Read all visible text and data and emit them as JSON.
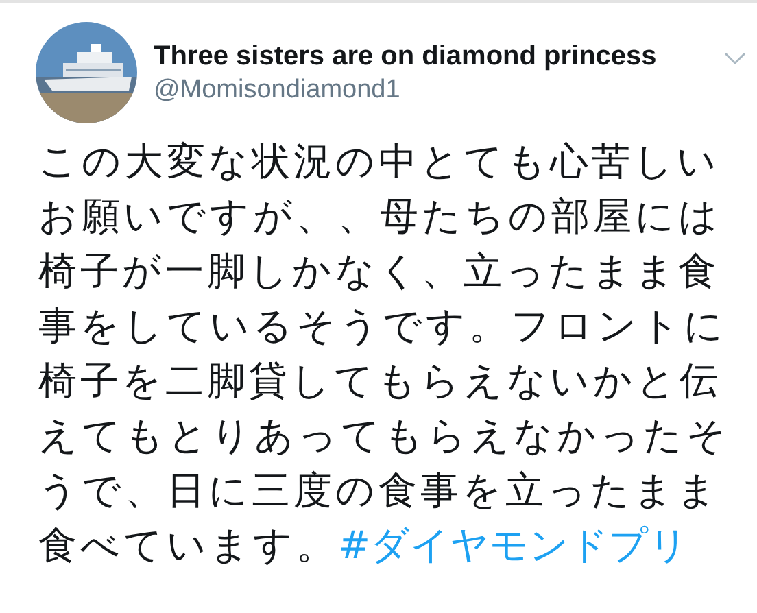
{
  "tweet": {
    "display_name": "Three sisters are on diamond princess",
    "handle": "@Momisondiamond1",
    "text": "この大変な状況の中とても心苦しいお願いですが、、母たちの部屋には椅子が一脚しかなく、立ったまま食事をしているそうです。フロントに椅子を二脚貸してもらえないかと伝えてもとりあってもらえなかったそうで、日に三度の食事を立ったまま食べています。",
    "hashtag": "#ダイヤモンドプリ"
  }
}
